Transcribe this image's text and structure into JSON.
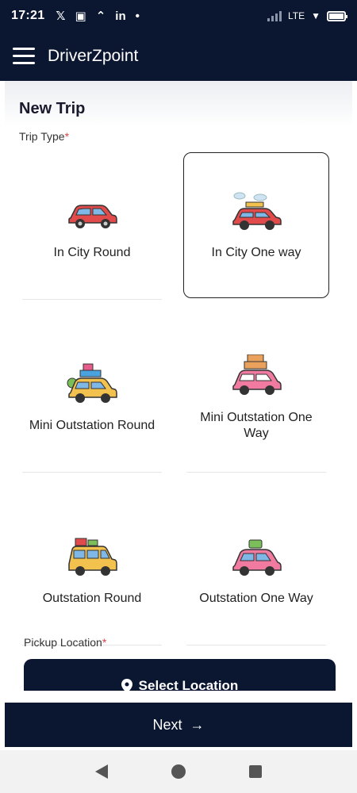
{
  "status_bar": {
    "time": "17:21",
    "battery": "91",
    "network": "LTE"
  },
  "app_bar": {
    "title": "DriverZpoint"
  },
  "page": {
    "title": "New Trip"
  },
  "trip_type": {
    "label": "Trip Type",
    "required_mark": "*",
    "options": [
      {
        "label": "In City Round",
        "icon": "red-car-icon",
        "selected": false
      },
      {
        "label": "In City One way",
        "icon": "car-with-luggage-icon",
        "selected": true
      },
      {
        "label": "Mini Outstation Round",
        "icon": "yellow-car-luggage-icon",
        "selected": false
      },
      {
        "label": "Mini Outstation One Way",
        "icon": "pink-car-luggage-icon",
        "selected": false
      },
      {
        "label": "Outstation Round",
        "icon": "yellow-suv-icon",
        "selected": false
      },
      {
        "label": "Outstation One Way",
        "icon": "pink-car-icon",
        "selected": false
      }
    ]
  },
  "pickup": {
    "label": "Pickup Location",
    "required_mark": "*",
    "button_label": "Select Location"
  },
  "footer": {
    "next_label": "Next",
    "next_icon": "→"
  },
  "colors": {
    "primary": "#0b1631",
    "accent_required": "#dd4444"
  }
}
